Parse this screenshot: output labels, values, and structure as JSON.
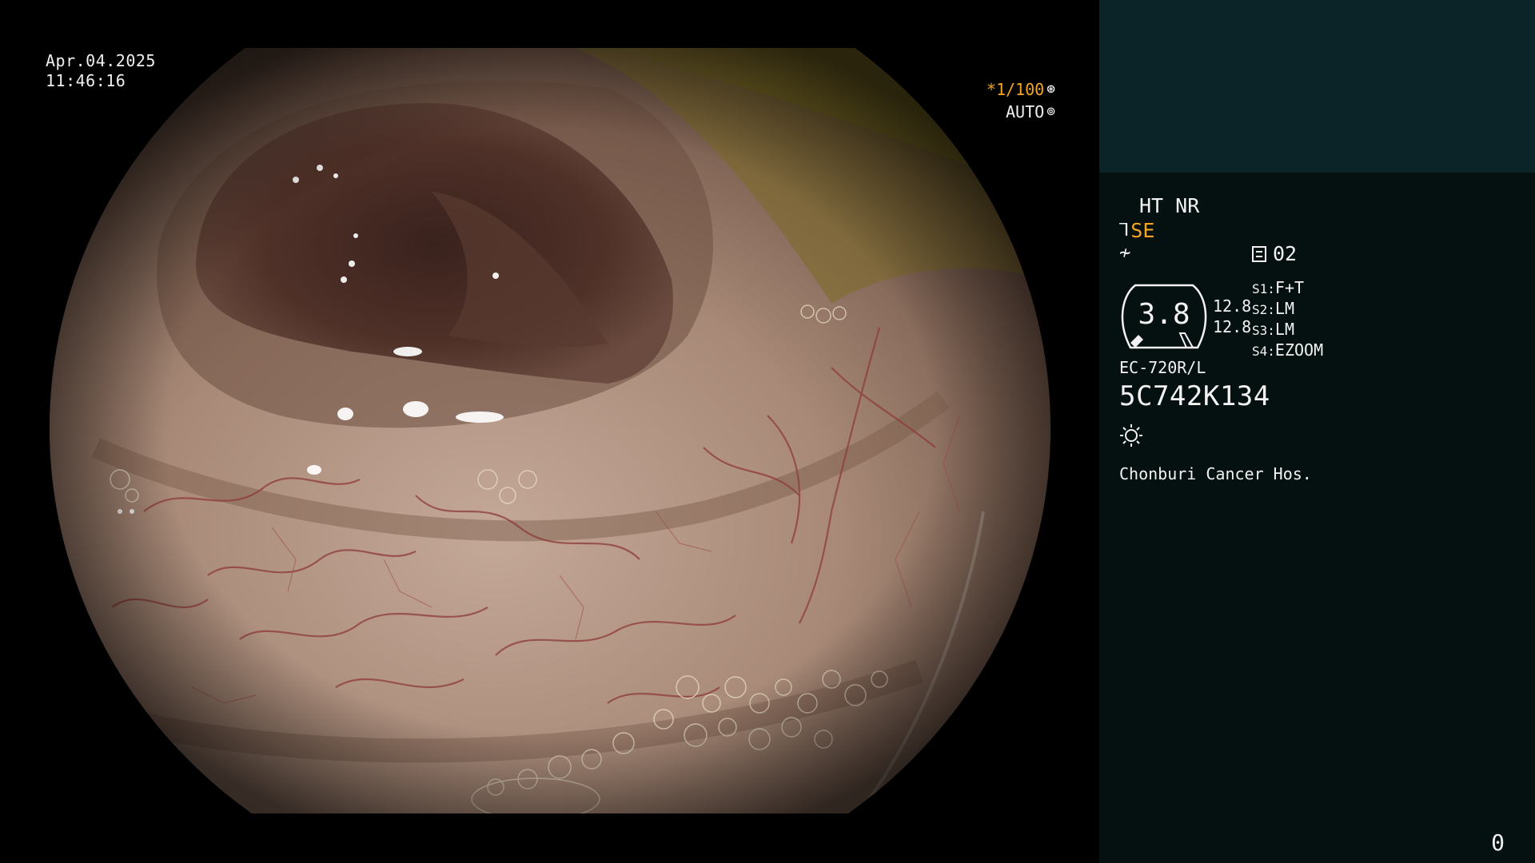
{
  "header": {
    "date": "Apr.04.2025",
    "time": "11:46:16"
  },
  "shutter": {
    "speed": "*1/100",
    "speed_icon": "shutter-icon",
    "mode": "AUTO",
    "mode_icon": "iris-icon"
  },
  "panel": {
    "ht_nr": "HT NR",
    "se_label": "SE",
    "se_icon": "enhance-icon",
    "f_icon": "f-curve-icon",
    "memo_icon": "memo-icon",
    "memo_value": "02",
    "gauge_value": "3.8",
    "side_values": [
      "12.8",
      "12.8"
    ],
    "switches": [
      {
        "key": "S1:",
        "value": "F+T"
      },
      {
        "key": "S2:",
        "value": "LM"
      },
      {
        "key": "S3:",
        "value": "LM"
      },
      {
        "key": "S4:",
        "value": "EZOOM"
      }
    ],
    "scope_model": "EC-720R/L",
    "serial": "5C742K134",
    "light_icon": "sun-icon",
    "hospital": "Chonburi Cancer Hos.",
    "counter": "0"
  },
  "colors": {
    "accent": "#f5a623",
    "panel_top": "#0b2427",
    "panel_main": "#051110",
    "mucosa": "#a98b78",
    "vessel": "#8e3a3a"
  }
}
